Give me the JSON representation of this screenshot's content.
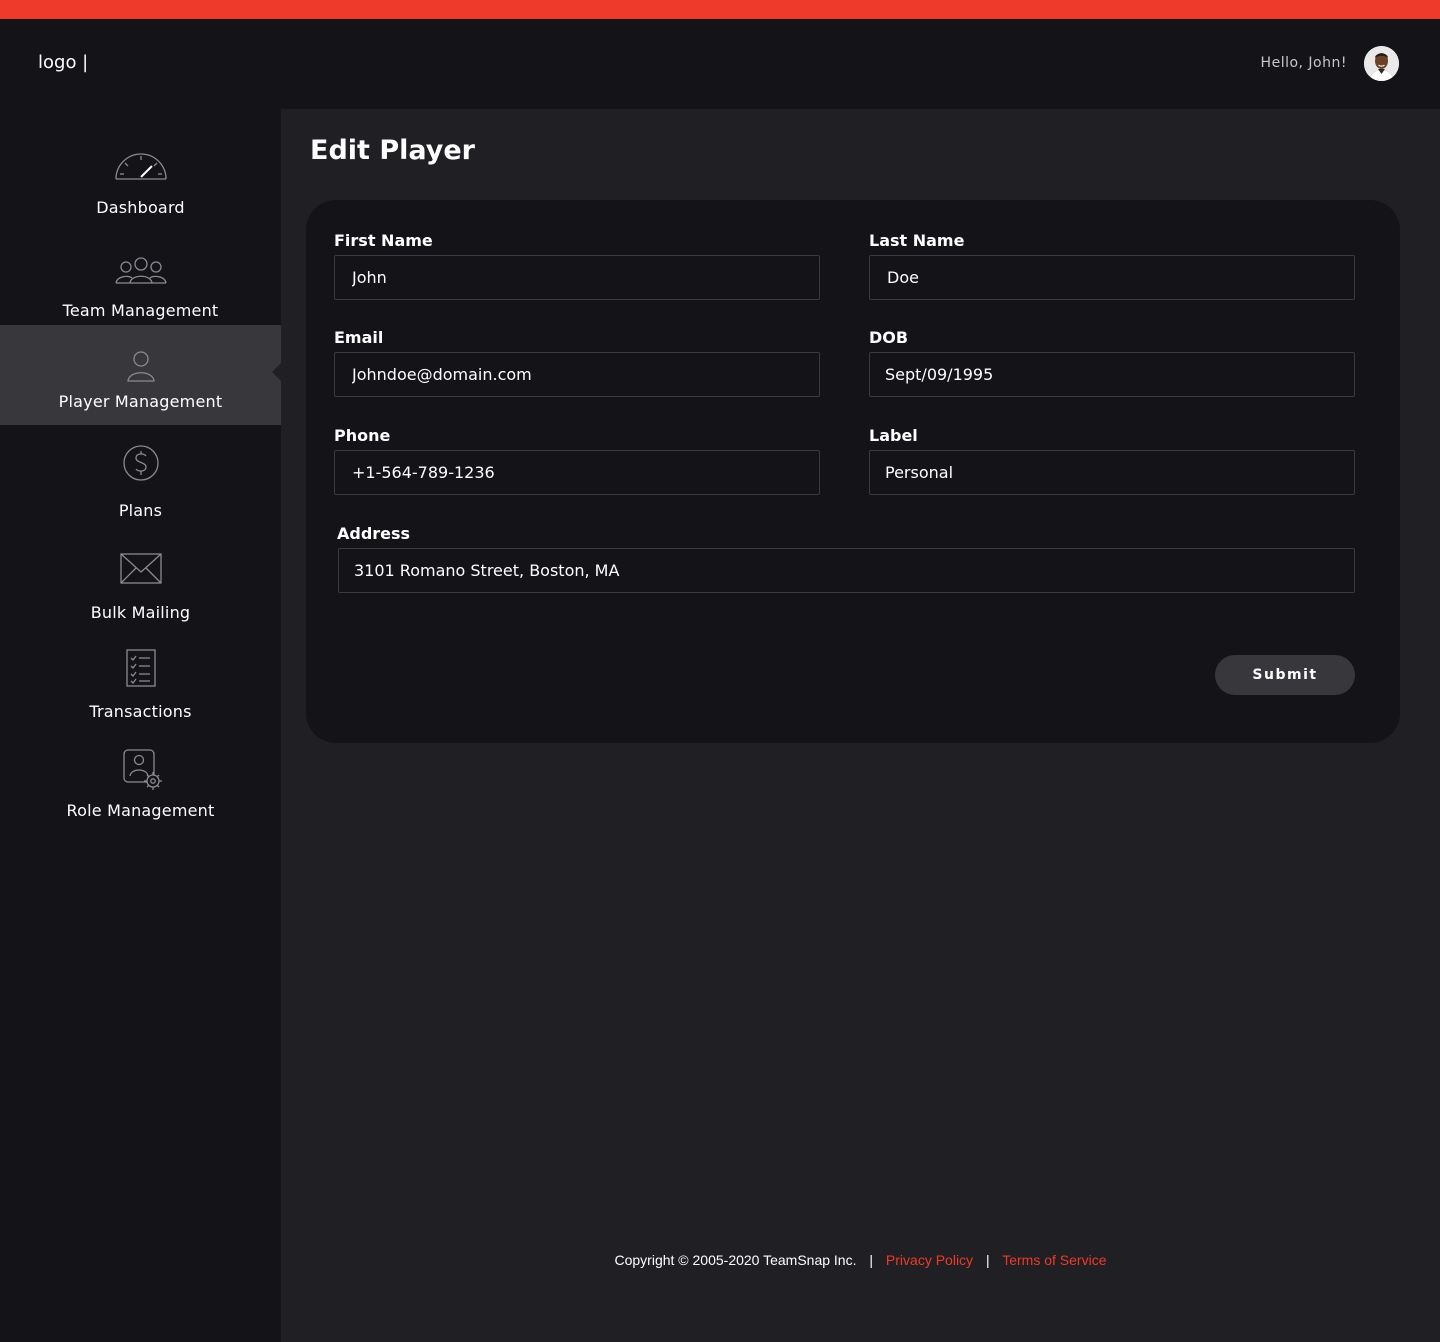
{
  "header": {
    "logo_text": "logo |",
    "greeting": "Hello, John!"
  },
  "sidebar": {
    "items": [
      {
        "label": "Dashboard",
        "icon": "speedometer-icon"
      },
      {
        "label": "Team Management",
        "icon": "group-icon"
      },
      {
        "label": "Player Management",
        "icon": "user-icon",
        "active": true
      },
      {
        "label": "Plans",
        "icon": "dollar-icon"
      },
      {
        "label": "Bulk Mailing",
        "icon": "envelope-icon"
      },
      {
        "label": "Transactions",
        "icon": "checklist-icon"
      },
      {
        "label": "Role Management",
        "icon": "user-gear-icon"
      }
    ]
  },
  "page": {
    "title": "Edit Player"
  },
  "form": {
    "first_name": {
      "label": "First Name",
      "value": "John"
    },
    "last_name": {
      "label": "Last Name",
      "value": "Doe"
    },
    "email": {
      "label": "Email",
      "value": "Johndoe@domain.com"
    },
    "dob": {
      "label": "DOB",
      "value": "Sept/09/1995"
    },
    "phone": {
      "label": "Phone",
      "value": "+1-564-789-1236"
    },
    "label_field": {
      "label": "Label",
      "value": "Personal"
    },
    "address": {
      "label": "Address",
      "value": "3101 Romano Street, Boston, MA"
    },
    "submit_label": "Submit"
  },
  "footer": {
    "copyright": "Copyright © 2005-2020 TeamSnap Inc.",
    "separator": "|",
    "privacy": "Privacy Policy",
    "terms": "Terms of Service"
  },
  "colors": {
    "accent": "#ee3a2b",
    "background": "#1f1f24",
    "panel": "#131318",
    "active_nav": "#38383c"
  }
}
